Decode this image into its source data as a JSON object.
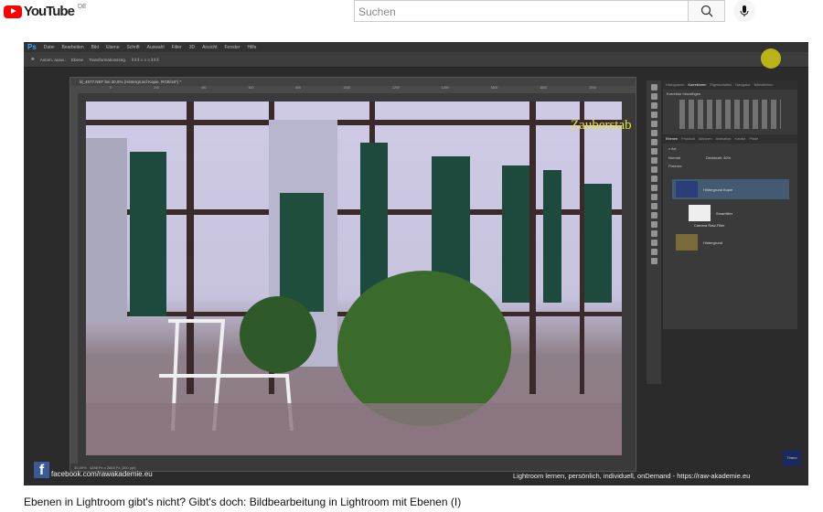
{
  "header": {
    "logo": "YouTube",
    "country": "DE",
    "search_placeholder": "Suchen",
    "search_icon": "search-icon",
    "mic_icon": "mic-icon"
  },
  "photoshop": {
    "app": "Ps",
    "menu": [
      "Datei",
      "Bearbeiten",
      "Bild",
      "Ebene",
      "Schrift",
      "Auswahl",
      "Filter",
      "3D",
      "Ansicht",
      "Fenster",
      "Hilfe"
    ],
    "options": {
      "auto_select": "Autom. ausw.:",
      "layer_select": "Ebene",
      "transform": "Transformationsstrg."
    },
    "doc_title": "ld_4677.NEF bei 30,5% (Hintergrund Kopie, RGB/16*) *",
    "ruler_ticks": [
      "0",
      "200",
      "400",
      "600",
      "800",
      "1000",
      "1200",
      "1400",
      "1600",
      "1800",
      "2000"
    ],
    "status": {
      "zoom": "30,49%",
      "size": "4288 Px x 2848 Px (300 ppi)"
    },
    "panel_tabs_top": [
      "Histogramm",
      "Korrekturen",
      "Eigenschaften",
      "Navigator",
      "Bibliotheken"
    ],
    "corrections_label": "Korrektur hinzufügen",
    "panel_tabs_layers": [
      "Ebenen",
      "Protokoll",
      "Aktionen",
      "Animation",
      "Kanäle",
      "Pfade"
    ],
    "layer_filter": "Art",
    "blend_mode": "Normal",
    "opacity_label": "Deckkraft:",
    "opacity_value": "40%",
    "lock_label": "Fixieren:",
    "layers": [
      {
        "name": "Hintergrund Kopie",
        "selected": true
      },
      {
        "name": "Smartfilter"
      },
      {
        "name": "Camera Raw-Filter"
      },
      {
        "name": "Hintergrund"
      }
    ]
  },
  "overlay": {
    "annotation": "Zauberstab",
    "facebook": "facebook.com/rawakademie.eu",
    "promo": "Lightroom lernen, persönlich, individuell, onDemand - https://raw-akademie.eu",
    "badge": "Tirano"
  },
  "video_title": "Ebenen in Lightroom gibt's nicht? Gibt's doch: Bildbearbeitung in Lightroom mit Ebenen (I)"
}
